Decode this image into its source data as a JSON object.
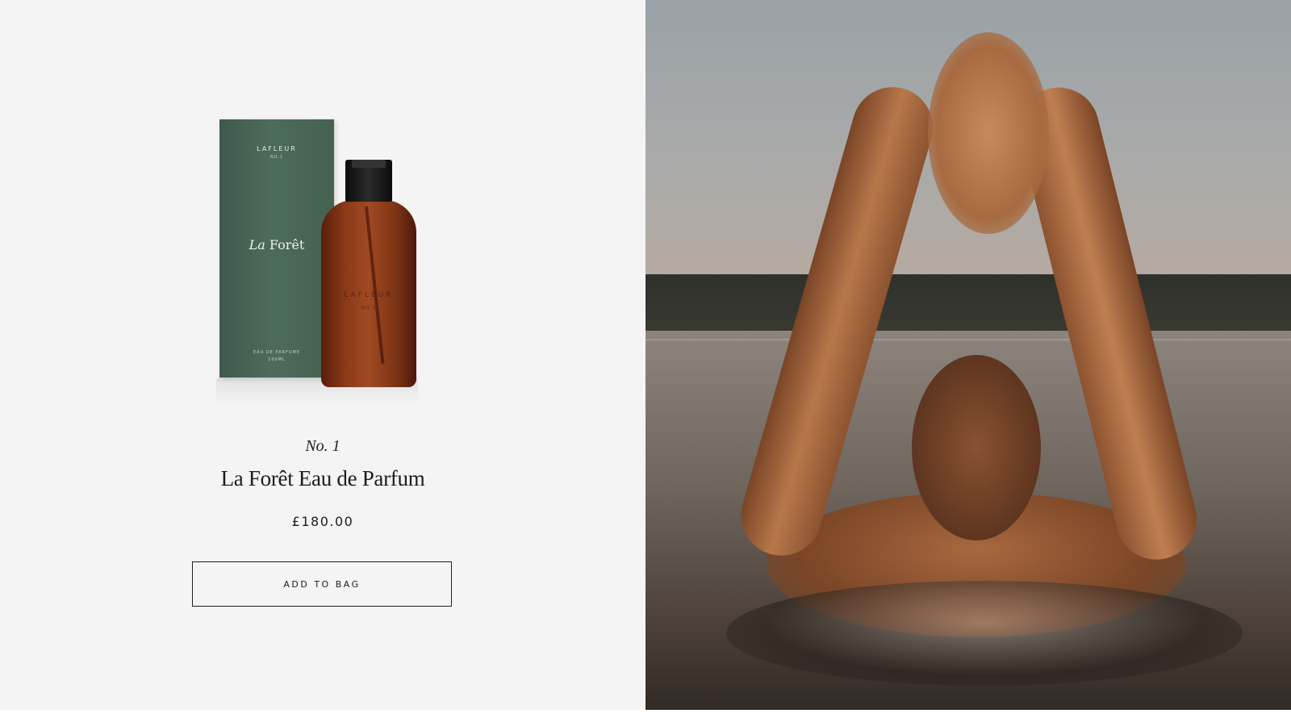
{
  "product": {
    "box_brand": "LAFLEUR",
    "box_no": "NO.1",
    "box_name_italic": "La",
    "box_name_rest": "Forêt",
    "box_type": "EAU DE PARFUME",
    "box_volume": "100ML",
    "bottle_brand": "LAFLEUR",
    "bottle_no": "NO.1",
    "subtitle": "No. 1",
    "title": "La Forêt Eau de Parfum",
    "price": "£180.00",
    "add_to_bag_label": "ADD TO BAG"
  },
  "colors": {
    "panel_left": "#f4f4f4",
    "box_green": "#4d6b5b",
    "bottle_amber": "#8a3a18",
    "text_dark": "#1c1c1c"
  },
  "lifestyle_image": {
    "description_icon": "photo-swimmer-icon"
  }
}
